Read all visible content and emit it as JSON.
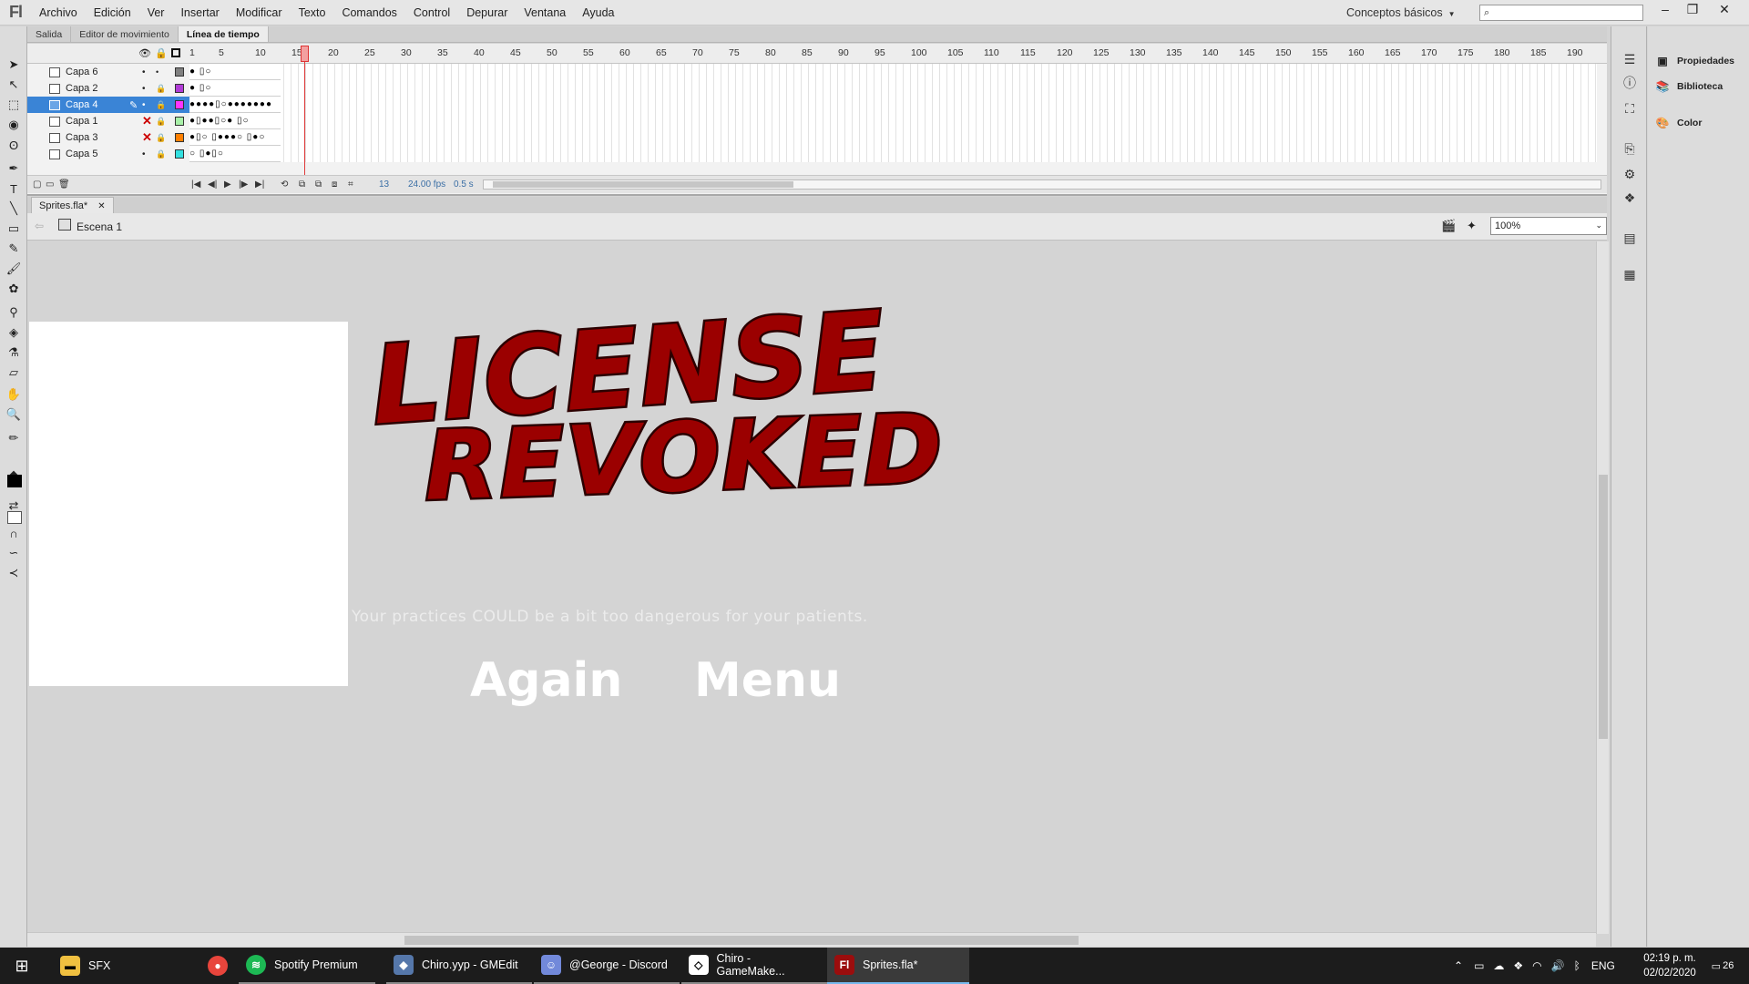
{
  "app": {
    "logo": "Fl"
  },
  "menu": [
    "Archivo",
    "Edición",
    "Ver",
    "Insertar",
    "Modificar",
    "Texto",
    "Comandos",
    "Control",
    "Depurar",
    "Ventana",
    "Ayuda"
  ],
  "workspace": {
    "label": "Conceptos básicos",
    "search_placeholder": ""
  },
  "window_controls": {
    "minimize": "–",
    "restore": "❐",
    "close": "✕"
  },
  "panel_tabs": [
    "Salida",
    "Editor de movimiento",
    "Línea de tiempo"
  ],
  "timeline": {
    "frame_numbers": [
      "1",
      "5",
      "10",
      "15",
      "20",
      "25",
      "30",
      "35",
      "40",
      "45",
      "50",
      "55",
      "60",
      "65",
      "70",
      "75",
      "80",
      "85",
      "90",
      "95",
      "100",
      "105",
      "110",
      "115",
      "120",
      "125",
      "130",
      "135",
      "140",
      "145",
      "150",
      "155",
      "160",
      "165",
      "170",
      "175",
      "180",
      "185",
      "190"
    ],
    "layers": [
      {
        "name": "Capa 6",
        "color": "#808080",
        "frames": "●    ▯○"
      },
      {
        "name": "Capa 2",
        "color": "#b03bd6",
        "frames": "●    ▯○"
      },
      {
        "name": "Capa 4",
        "color": "#ff33ff",
        "frames": "●●●●▯○●●●●●●●"
      },
      {
        "name": "Capa 1",
        "color": "#a8f0a8",
        "frames": "●▯●●▯○●   ▯○"
      },
      {
        "name": "Capa 3",
        "color": "#ff7f00",
        "frames": "●▯○ ▯●●●○ ▯●○"
      },
      {
        "name": "Capa 5",
        "color": "#33e0e0",
        "frames": "○ ▯●▯○"
      }
    ],
    "current_frame": "13",
    "fps": "24.00 fps",
    "time": "0.5 s"
  },
  "document": {
    "tab": "Sprites.fla*",
    "scene": "Escena 1",
    "zoom": "100%"
  },
  "stage": {
    "title_line1": "LICENSE",
    "title_line2": "REVOKED",
    "subtitle": "Your practices COULD be a bit too dangerous for your patients.",
    "again_button": "Again",
    "menu_button": "Menu"
  },
  "right_panel": [
    "Propiedades",
    "Biblioteca",
    "Color"
  ],
  "taskbar": {
    "items": [
      {
        "label": "SFX"
      },
      {
        "label": ""
      },
      {
        "label": "Spotify Premium"
      },
      {
        "label": "Chiro.yyp - GMEdit"
      },
      {
        "label": "@George - Discord"
      },
      {
        "label": "Chiro - GameMake..."
      },
      {
        "label": "Sprites.fla*"
      }
    ],
    "language": "ENG",
    "time": "02:19 p. m.",
    "date": "02/02/2020",
    "notifications": "26"
  }
}
